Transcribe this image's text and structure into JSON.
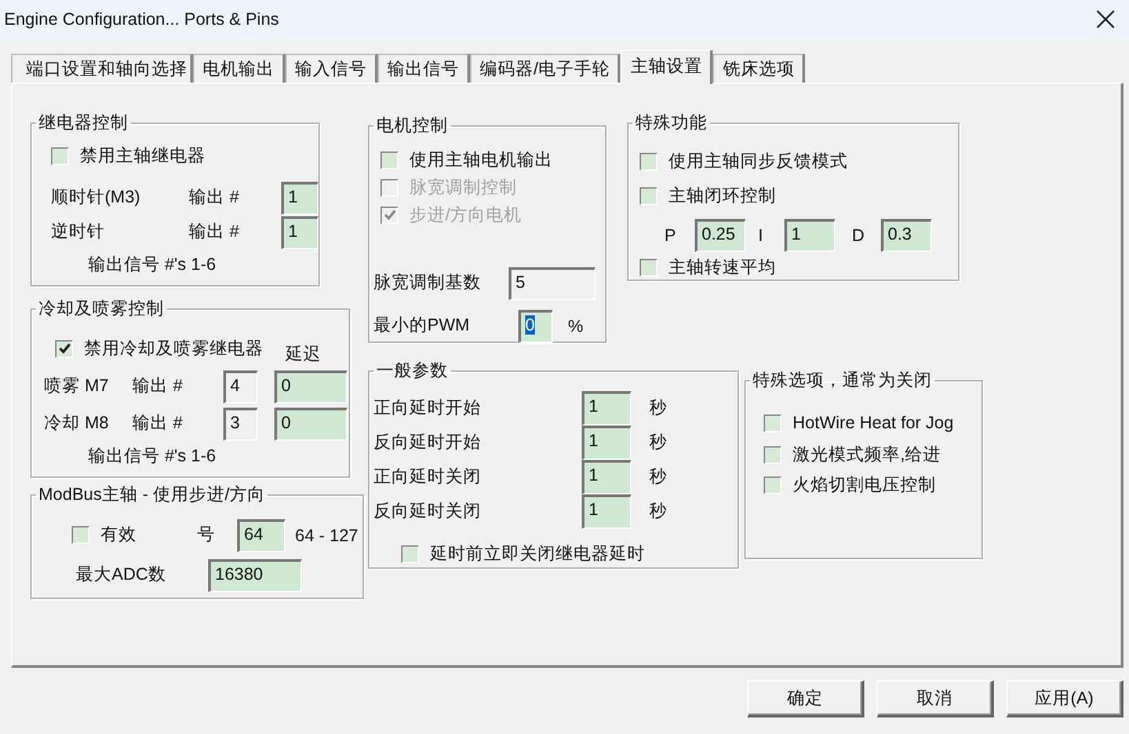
{
  "window": {
    "title": "Engine Configuration... Ports & Pins"
  },
  "tabs": [
    {
      "label": "端口设置和轴向选择",
      "selected": false
    },
    {
      "label": "电机输出",
      "selected": false
    },
    {
      "label": "输入信号",
      "selected": false
    },
    {
      "label": "输出信号",
      "selected": false
    },
    {
      "label": "编码器/电子手轮",
      "selected": false
    },
    {
      "label": "主轴设置",
      "selected": true
    },
    {
      "label": "铣床选项",
      "selected": false
    }
  ],
  "groups": [
    {
      "title": "继电器控制",
      "lines": [
        [
          {
            "kind": "checkbox",
            "label": "禁用主轴继电器",
            "checked": false,
            "disabled": false
          }
        ],
        [
          {
            "kind": "text",
            "text": "顺时针(M3)"
          },
          {
            "kind": "text",
            "text": "输出 #"
          },
          {
            "kind": "field",
            "value": "1",
            "disabled": false,
            "focused": false
          }
        ],
        [
          {
            "kind": "text",
            "text": "逆时针"
          },
          {
            "kind": "text",
            "text": "输出 #"
          },
          {
            "kind": "field",
            "value": "1",
            "disabled": false,
            "focused": false
          }
        ],
        [
          {
            "kind": "text",
            "text": "输出信号 #'s 1-6"
          }
        ]
      ]
    },
    {
      "title": "冷却及喷雾控制",
      "lines": [
        [
          {
            "kind": "checkbox",
            "label": "禁用冷却及喷雾继电器",
            "checked": true,
            "disabled": false
          },
          {
            "kind": "text",
            "text": "延迟"
          }
        ],
        [
          {
            "kind": "text",
            "text": "喷雾 M7"
          },
          {
            "kind": "text",
            "text": "输出 #"
          },
          {
            "kind": "field",
            "value": "4",
            "disabled": true,
            "focused": false
          },
          {
            "kind": "field",
            "value": "0",
            "disabled": false,
            "focused": false
          }
        ],
        [
          {
            "kind": "text",
            "text": "冷却 M8"
          },
          {
            "kind": "text",
            "text": "输出 #"
          },
          {
            "kind": "field",
            "value": "3",
            "disabled": true,
            "focused": false
          },
          {
            "kind": "field",
            "value": "0",
            "disabled": false,
            "focused": false
          }
        ],
        [
          {
            "kind": "text",
            "text": "输出信号 #'s 1-6"
          }
        ]
      ]
    },
    {
      "title": "ModBus主轴 - 使用步进/方向",
      "lines": [
        [
          {
            "kind": "checkbox",
            "label": "有效",
            "checked": false,
            "disabled": false
          },
          {
            "kind": "text",
            "text": "号"
          },
          {
            "kind": "field",
            "value": "64",
            "disabled": false,
            "focused": false
          },
          {
            "kind": "text",
            "text": "64 - 127"
          }
        ],
        [
          {
            "kind": "text",
            "text": "最大ADC数"
          },
          {
            "kind": "field",
            "value": "16380",
            "disabled": false,
            "focused": false
          }
        ]
      ]
    },
    {
      "title": "电机控制",
      "lines": [
        [
          {
            "kind": "checkbox",
            "label": "使用主轴电机输出",
            "checked": false,
            "disabled": false
          }
        ],
        [
          {
            "kind": "checkbox",
            "label": "脉宽调制控制",
            "checked": false,
            "disabled": true
          }
        ],
        [
          {
            "kind": "checkbox",
            "label": "步进/方向电机",
            "checked": true,
            "disabled": true
          }
        ],
        [
          {
            "kind": "text",
            "text": "脉宽调制基数"
          },
          {
            "kind": "field",
            "value": "5",
            "disabled": true,
            "focused": false
          }
        ],
        [
          {
            "kind": "text",
            "text": "最小的PWM"
          },
          {
            "kind": "field",
            "value": "0",
            "disabled": false,
            "focused": true
          },
          {
            "kind": "text",
            "text": "%"
          }
        ]
      ]
    },
    {
      "title": "特殊功能",
      "lines": [
        [
          {
            "kind": "checkbox",
            "label": "使用主轴同步反馈模式",
            "checked": false,
            "disabled": false
          }
        ],
        [
          {
            "kind": "checkbox",
            "label": "主轴闭环控制",
            "checked": false,
            "disabled": false
          }
        ],
        [
          {
            "kind": "text",
            "text": "P"
          },
          {
            "kind": "field",
            "value": "0.25",
            "disabled": false,
            "focused": false
          },
          {
            "kind": "text",
            "text": "I"
          },
          {
            "kind": "field",
            "value": "1",
            "disabled": false,
            "focused": false
          },
          {
            "kind": "text",
            "text": "D"
          },
          {
            "kind": "field",
            "value": "0.3",
            "disabled": false,
            "focused": false
          }
        ],
        [
          {
            "kind": "checkbox",
            "label": "主轴转速平均",
            "checked": false,
            "disabled": false
          }
        ]
      ]
    },
    {
      "title": "一般参数",
      "lines": [
        [
          {
            "kind": "text",
            "text": "正向延时开始"
          },
          {
            "kind": "field",
            "value": "1",
            "disabled": false,
            "focused": false
          },
          {
            "kind": "text",
            "text": "秒"
          }
        ],
        [
          {
            "kind": "text",
            "text": "反向延时开始"
          },
          {
            "kind": "field",
            "value": "1",
            "disabled": false,
            "focused": false
          },
          {
            "kind": "text",
            "text": "秒"
          }
        ],
        [
          {
            "kind": "text",
            "text": "正向延时关闭"
          },
          {
            "kind": "field",
            "value": "1",
            "disabled": false,
            "focused": false
          },
          {
            "kind": "text",
            "text": "秒"
          }
        ],
        [
          {
            "kind": "text",
            "text": "反向延时关闭"
          },
          {
            "kind": "field",
            "value": "1",
            "disabled": false,
            "focused": false
          },
          {
            "kind": "text",
            "text": "秒"
          }
        ],
        [
          {
            "kind": "checkbox",
            "label": "延时前立即关闭继电器延时",
            "checked": false,
            "disabled": false
          }
        ]
      ]
    },
    {
      "title": "特殊选项，通常为关闭",
      "lines": [
        [
          {
            "kind": "checkbox",
            "label": "HotWire Heat for Jog",
            "checked": false,
            "disabled": false
          }
        ],
        [
          {
            "kind": "checkbox",
            "label": "激光模式频率,给进",
            "checked": false,
            "disabled": false
          }
        ],
        [
          {
            "kind": "checkbox",
            "label": "火焰切割电压控制",
            "checked": false,
            "disabled": false
          }
        ]
      ]
    }
  ],
  "buttons": [
    "确定",
    "取消",
    "应用(A)"
  ]
}
